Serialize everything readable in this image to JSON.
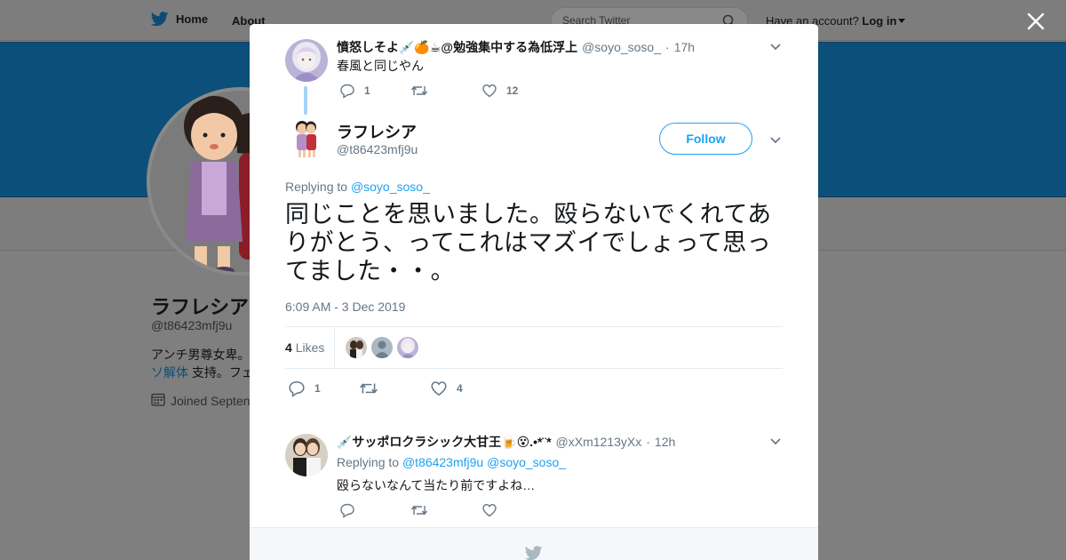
{
  "topbar": {
    "home_label": "Home",
    "about_label": "About",
    "search_placeholder": "Search Twitter",
    "account_prompt": "Have an account?",
    "login_label": "Log in"
  },
  "profile": {
    "name": "ラフレシア",
    "handle": "@t86423mfj9u",
    "bio_line1": "アンチ男尊女卑。",
    "bio_link": "ソ解体",
    "bio_line2_rest": " 支持。フェ",
    "joined": "Joined Septen"
  },
  "parent_tweet": {
    "name": "憤怒しそよ💉🍊☕@勉強集中する為低浮上",
    "handle": "@soyo_soso_",
    "separator": "·",
    "time": "17h",
    "text": "春風と同じやん",
    "reply_count": "1",
    "retweet_count": "",
    "like_count": "12"
  },
  "main_tweet": {
    "name": "ラフレシア",
    "handle": "@t86423mfj9u",
    "follow_label": "Follow",
    "replying_label": "Replying to",
    "replying_mention": "@soyo_soso_",
    "text": "同じことを思いました。殴らないでくれてありがとう、ってこれはマズイでしょって思ってました・・。",
    "date": "6:09 AM - 3 Dec 2019",
    "likes_count": "4",
    "likes_label": "Likes",
    "reply_count": "1",
    "retweet_count": "",
    "like_count": "4"
  },
  "reply_tweet": {
    "name": "💉サッポロクラシック大甘王🍺😵.•*¨*",
    "handle": "@xXm1213yXx",
    "separator": "·",
    "time": "12h",
    "replying_label": "Replying to",
    "mention1": "@t86423mfj9u",
    "mention2": "@soyo_soso_",
    "text": "殴らないなんて当たり前ですよね…"
  },
  "colors": {
    "accent": "#1da1f2",
    "overlay_header": "#0c4f7a",
    "text_secondary": "#657786",
    "thread_line": "#a3d3f5"
  }
}
